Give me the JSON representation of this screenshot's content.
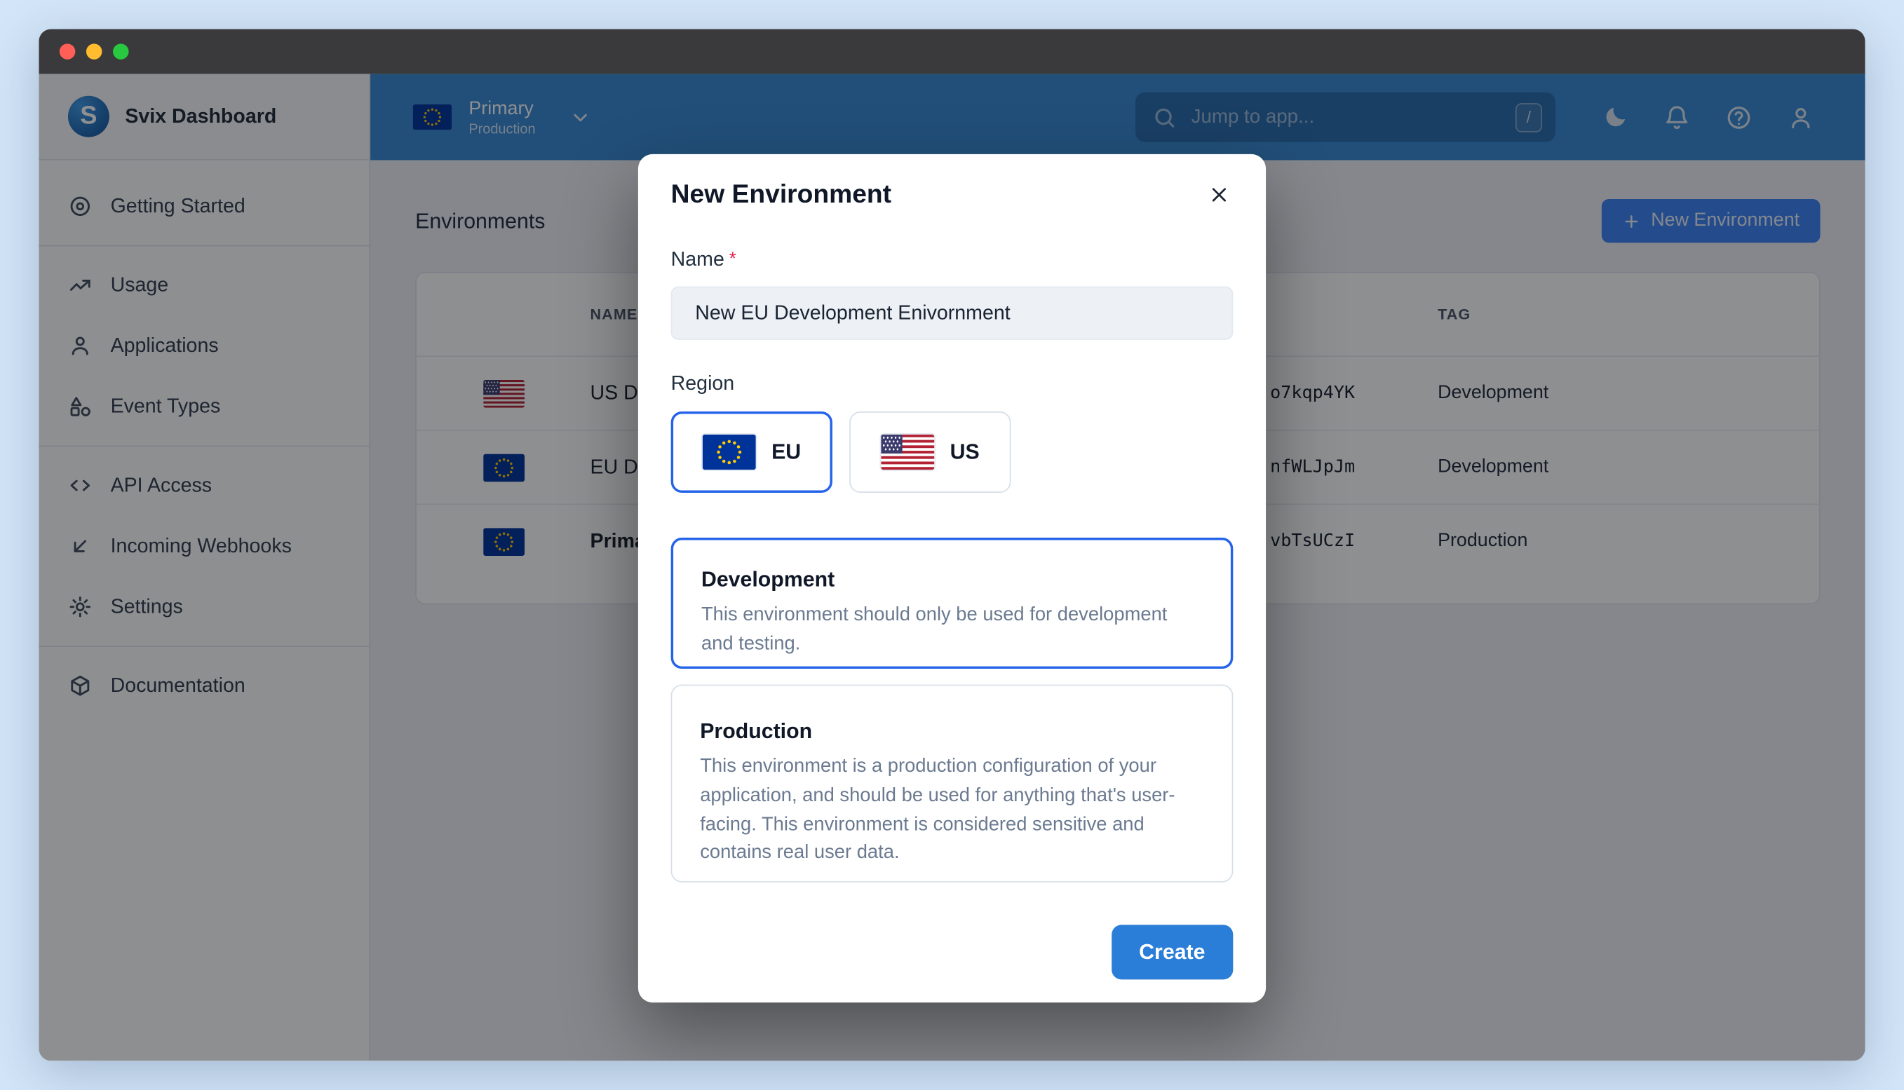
{
  "sidebar": {
    "brand": "Svix Dashboard",
    "items": [
      {
        "label": "Getting Started",
        "icon": "target-icon"
      },
      {
        "label": "Usage",
        "icon": "chart-icon"
      },
      {
        "label": "Applications",
        "icon": "person-icon"
      },
      {
        "label": "Event Types",
        "icon": "shapes-icon"
      },
      {
        "label": "API Access",
        "icon": "code-icon"
      },
      {
        "label": "Incoming Webhooks",
        "icon": "arrow-down-left-icon"
      },
      {
        "label": "Settings",
        "icon": "gear-icon"
      },
      {
        "label": "Documentation",
        "icon": "package-icon"
      }
    ]
  },
  "topbar": {
    "env_switcher": {
      "name": "Primary",
      "tag": "Production",
      "flag": "eu"
    },
    "search": {
      "placeholder": "Jump to app...",
      "shortcut": "/"
    },
    "icons": [
      "moon-icon",
      "bell-icon",
      "help-icon",
      "user-icon"
    ]
  },
  "page": {
    "title": "Environments",
    "new_env_button": "New Environment",
    "table": {
      "headers": [
        "NAME",
        "TAG"
      ],
      "rows": [
        {
          "flag": "us",
          "name": "US Development",
          "id_fragment": "o7kqp4YK",
          "tag": "Development",
          "bold": false
        },
        {
          "flag": "eu",
          "name": "EU Development",
          "id_fragment": "nfWLJpJm",
          "tag": "Development",
          "bold": false
        },
        {
          "flag": "eu",
          "name": "Primary",
          "id_fragment": "vbTsUCzI",
          "tag": "Production",
          "bold": true
        }
      ]
    }
  },
  "modal": {
    "title": "New Environment",
    "name_label": "Name",
    "required_mark": "*",
    "name_value": "New EU Development Enivornment",
    "region_label": "Region",
    "regions": [
      {
        "label": "EU",
        "flag": "eu",
        "selected": true
      },
      {
        "label": "US",
        "flag": "us",
        "selected": false
      }
    ],
    "env_types": [
      {
        "title": "Development",
        "description": "This environment should only be used for development and testing.",
        "selected": true
      },
      {
        "title": "Production",
        "description": "This environment is a production configuration of your application, and should be used for anything that's user-facing. This environment is considered sensitive and contains real user data.",
        "selected": false
      }
    ],
    "create_button": "Create"
  },
  "colors": {
    "accent_selected_border": "#2563eb",
    "topbar_blue": "#3789d3",
    "create_button_blue": "#2b7ed8",
    "page_background": "#d3e5f8"
  }
}
